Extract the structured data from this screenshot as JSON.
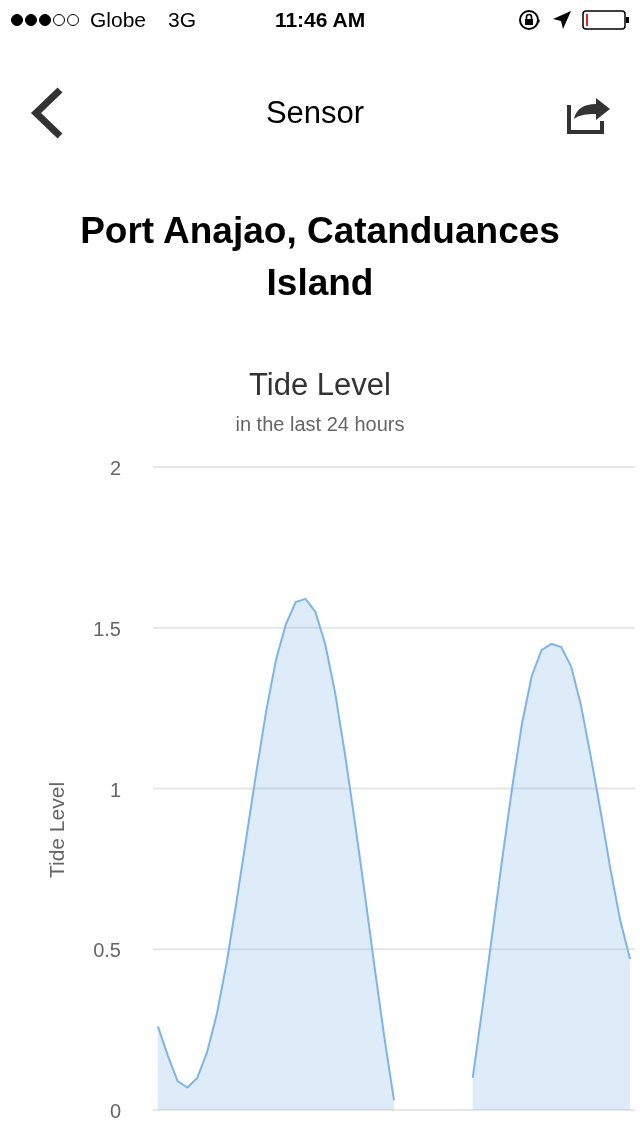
{
  "status_bar": {
    "carrier": "Globe",
    "network": "3G",
    "time": "11:46 AM"
  },
  "nav_bar": {
    "title": "Sensor"
  },
  "location_title": "Port Anajao, Catanduances Island",
  "chart": {
    "title": "Tide Level",
    "subtitle": "in the last 24 hours",
    "chart_data": {
      "type": "area",
      "ylabel": "Tide Level",
      "grid": true,
      "ylim": [
        0,
        2
      ],
      "yticks": [
        {
          "value": 0,
          "label": "0"
        },
        {
          "value": 0.5,
          "label": "0.5"
        },
        {
          "value": 1,
          "label": "1"
        },
        {
          "value": 1.5,
          "label": "1.5"
        },
        {
          "value": 2,
          "label": "2"
        }
      ],
      "categories": [
        null,
        null,
        null,
        null,
        null,
        null,
        null,
        null,
        null,
        null,
        null,
        null,
        null,
        null,
        null,
        null,
        null,
        null,
        null,
        null,
        null,
        null,
        null,
        null,
        null,
        null,
        null,
        null,
        null,
        null,
        null,
        null,
        null,
        null,
        null,
        null,
        null,
        null,
        null,
        null,
        null,
        null,
        null,
        null,
        null,
        null,
        null,
        null,
        null
      ],
      "series": [
        {
          "color": "#7cb5ec",
          "values": [
            0.26,
            0.17,
            0.09,
            0.07,
            0.1,
            0.18,
            0.3,
            0.46,
            0.65,
            0.85,
            1.05,
            1.24,
            1.4,
            1.51,
            1.58,
            1.59,
            1.55,
            1.45,
            1.3,
            1.11,
            0.9,
            0.68,
            0.45,
            0.23,
            0.03,
            null,
            null,
            null,
            null,
            null,
            null,
            null,
            0.1,
            0.32,
            0.55,
            0.78,
            1.0,
            1.2,
            1.35,
            1.43,
            1.45,
            1.44,
            1.38,
            1.26,
            1.1,
            0.93,
            0.75,
            0.59,
            0.47
          ]
        }
      ]
    }
  }
}
